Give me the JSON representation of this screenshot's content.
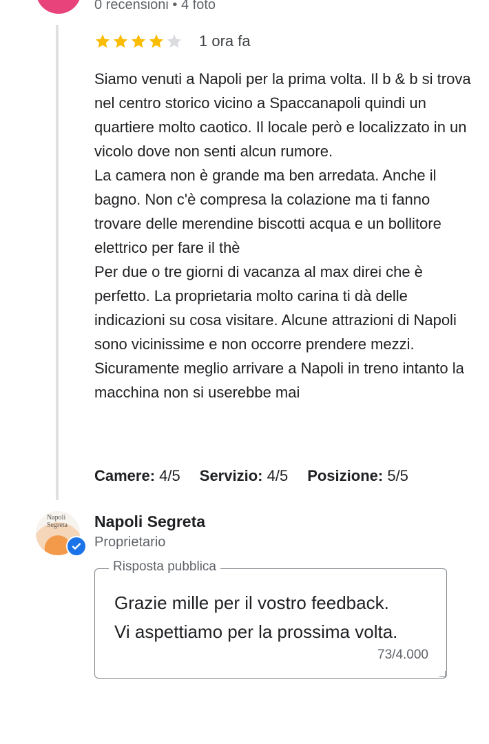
{
  "reviewer": {
    "meta": "0 recensioni • 4 foto"
  },
  "review": {
    "rating": 4,
    "max_rating": 5,
    "time": "1 ora fa",
    "paragraphs": [
      "Siamo venuti a Napoli per la prima volta. Il b & b si trova nel centro storico vicino a Spaccanapoli quindi un quartiere molto caotico. Il locale però e localizzato in un vicolo dove non senti alcun rumore.",
      "La camera non è grande ma ben arredata. Anche il bagno. Non c'è compresa la colazione ma ti fanno trovare delle merendine biscotti acqua e un bollitore elettrico per fare il thè",
      "Per due o tre giorni di vacanza al max direi che è perfetto. La proprietaria molto carina ti dà delle indicazioni su cosa visitare. Alcune attrazioni di Napoli sono vicinissime e non occorre prendere mezzi.",
      "Sicuramente meglio arrivare a Napoli in treno intanto la macchina non si userebbe mai"
    ],
    "scores": [
      {
        "name": "Camere:",
        "value": "4/5"
      },
      {
        "name": "Servizio:",
        "value": "4/5"
      },
      {
        "name": "Posizione:",
        "value": "5/5"
      }
    ]
  },
  "owner": {
    "name": "Napoli Segreta",
    "role": "Proprietario",
    "avatar_text": "Napoli Segreta"
  },
  "reply": {
    "legend": "Risposta pubblica",
    "lines": [
      "Grazie mille per il vostro feedback.",
      "Vi aspettiamo per la prossima volta."
    ],
    "char_count": "73/4.000"
  },
  "colors": {
    "star_filled": "#fbbc04",
    "star_empty": "#dadce0",
    "reviewer_avatar": "#e8437a",
    "verified_badge": "#1a73e8"
  },
  "icons": {
    "star": "star-icon",
    "verified": "verified-check-icon"
  }
}
